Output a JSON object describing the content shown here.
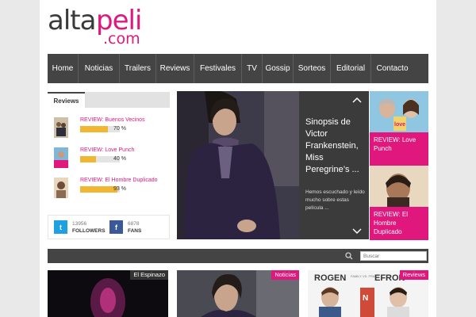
{
  "logo": {
    "part1": "alta",
    "part2": "peli",
    "part3": ".com"
  },
  "nav": {
    "items": [
      "Home",
      "Noticias",
      "Trailers",
      "Reviews",
      "Festivales",
      "TV",
      "Gossip",
      "Sorteos",
      "Editorial",
      "Contacto"
    ]
  },
  "reviews_widget": {
    "tab_label": "Reviews",
    "items": [
      {
        "title": "REVIEW: Buenos Vecinos",
        "percent_label": "70 %",
        "percent": 70
      },
      {
        "title": "REVIEW: Love Punch",
        "percent_label": "40 %",
        "percent": 40
      },
      {
        "title": "REVIEW: El Hombre Duplicado",
        "percent_label": "93 %",
        "percent": 93
      }
    ]
  },
  "social": {
    "twitter": {
      "count": "13956",
      "label": "FOLLOWERS"
    },
    "facebook": {
      "count": "6878",
      "label": "FANS"
    }
  },
  "slider": {
    "title": "Sinopsis de Victor Frankenstein, Miss Peregrine’s ...",
    "excerpt": "Hemos escuchado y leído mucho sobre estas película ...",
    "up_arrow": "chevron-up-icon",
    "down_arrow": "chevron-down-icon"
  },
  "side_cards": [
    {
      "caption": "REVIEW: Love Punch"
    },
    {
      "caption": "REVIEW: El Hombre Duplicado"
    }
  ],
  "search": {
    "placeholder": "Buscar"
  },
  "cards": [
    {
      "badge": "El Espinazo"
    },
    {
      "badge": "Noticias"
    },
    {
      "badge": "Reviews",
      "poster_text_1": "ROGEN",
      "poster_text_2": "EFRON",
      "poster_small": "FAMILY VS. FRAT"
    }
  ],
  "colors": {
    "brand_pink": "#e0177c",
    "nav_dark": "#444444",
    "rating_yellow": "#f1b733",
    "twitter": "#1da1e2",
    "facebook": "#3b5998"
  }
}
